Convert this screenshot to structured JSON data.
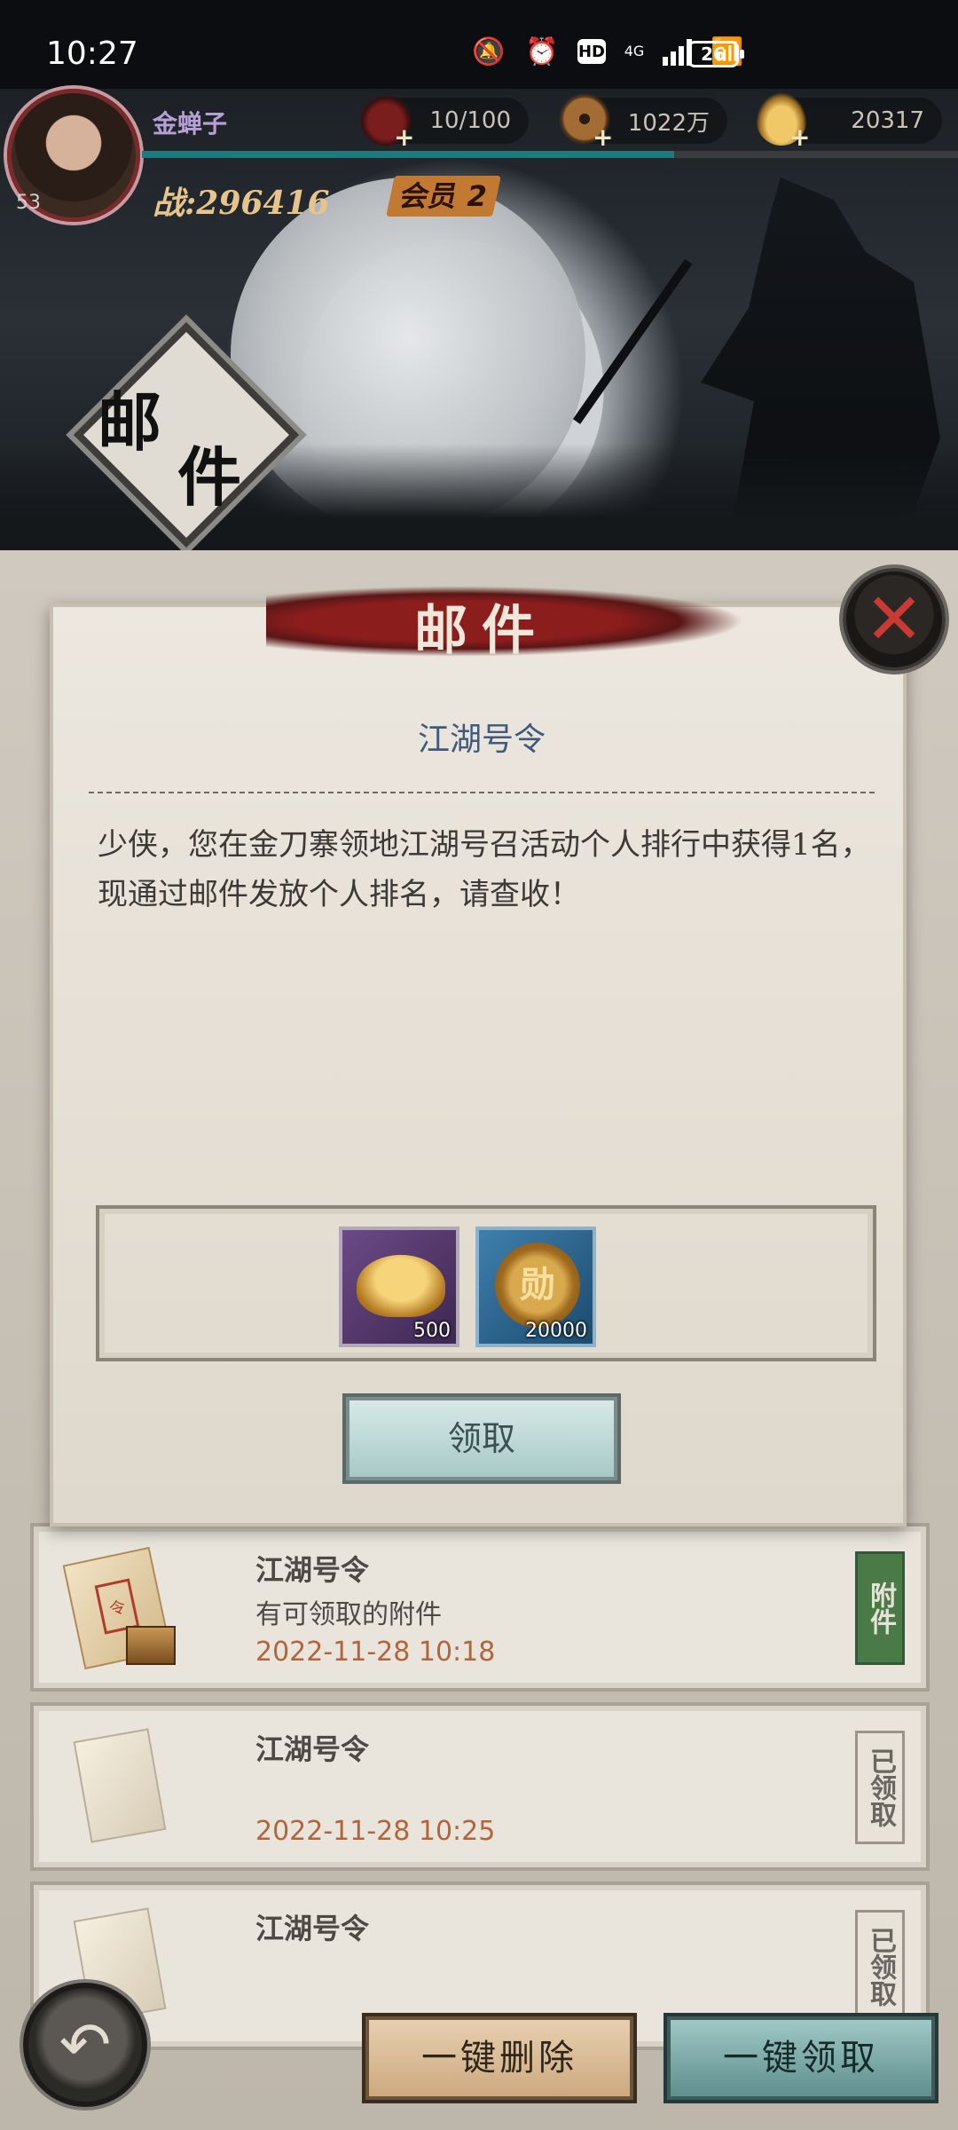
{
  "status_bar": {
    "time": "10:27",
    "network": "4G",
    "hd": "HD",
    "battery": "26"
  },
  "header": {
    "player_name": "金蝉子",
    "level": "53",
    "power_label": "战:296416",
    "vip_label": "会员 2",
    "resources": [
      {
        "icon": "stamina-jar-icon",
        "value": "10/100"
      },
      {
        "icon": "copper-coin-icon",
        "value": "1022万"
      },
      {
        "icon": "gold-ingot-icon",
        "value": "20317"
      }
    ],
    "page_title_chars": [
      "邮",
      "件"
    ]
  },
  "dialog": {
    "title": "邮件",
    "subject": "江湖号令",
    "body": "少侠，您在金刀寨领地江湖号召活动个人排行中获得1名，现通过邮件发放个人排名，请查收！",
    "attachments": [
      {
        "icon": "gold-ingot-icon",
        "qty": "500"
      },
      {
        "icon": "merit-coin-icon",
        "glyph": "勋",
        "qty": "20000"
      }
    ],
    "claim_label": "领取"
  },
  "mail_list": [
    {
      "title": "江湖号令",
      "subtitle": "有可领取的附件",
      "date": "2022-11-28 10:18",
      "tag": "附件",
      "tag_color": "#4a7a46"
    },
    {
      "title": "江湖号令",
      "subtitle": "",
      "date": "2022-11-28 10:25",
      "tag": "已领取",
      "tag_color": "#e8e3d9"
    },
    {
      "title": "江湖号令",
      "subtitle": "",
      "date": "",
      "tag": "已领取",
      "tag_color": "#e8e3d9"
    }
  ],
  "footer": {
    "delete_all_label": "一键删除",
    "claim_all_label": "一键领取"
  }
}
